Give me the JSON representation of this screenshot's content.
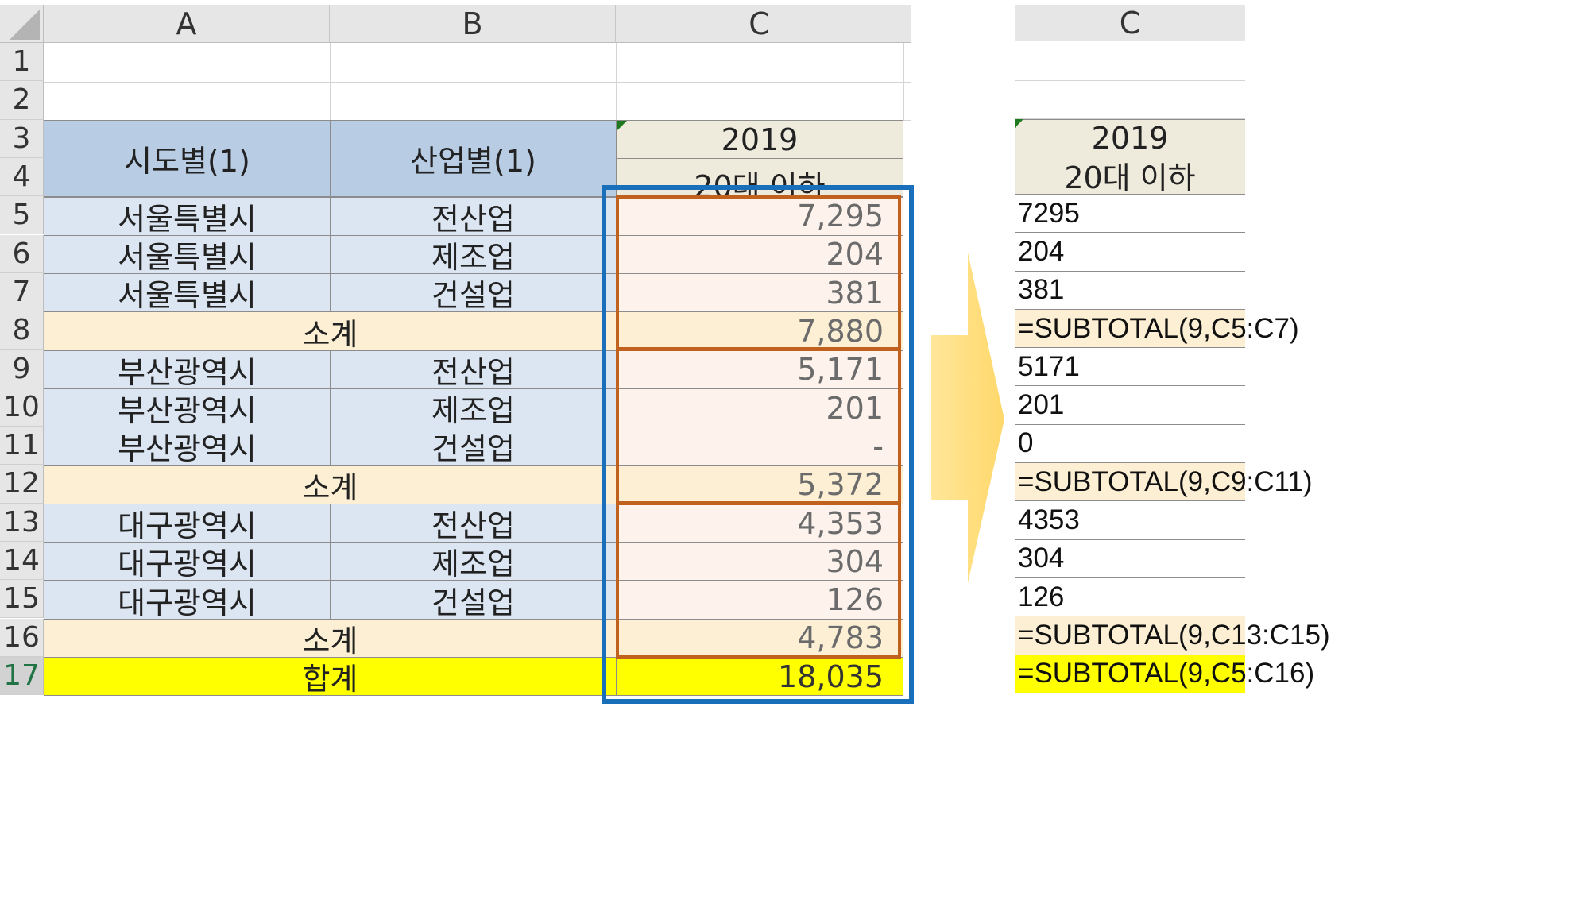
{
  "left_sheet": {
    "columns": [
      "A",
      "B",
      "C"
    ],
    "row_numbers": [
      "1",
      "2",
      "3",
      "4",
      "5",
      "6",
      "7",
      "8",
      "9",
      "10",
      "11",
      "12",
      "13",
      "14",
      "15",
      "16",
      "17"
    ],
    "header": {
      "col_a": "시도별(1)",
      "col_b": "산업별(1)",
      "year": "2019",
      "age": "20대 이하"
    },
    "rows": [
      {
        "a": "서울특별시",
        "b": "전산업",
        "c": "7,295"
      },
      {
        "a": "서울특별시",
        "b": "제조업",
        "c": "204"
      },
      {
        "a": "서울특별시",
        "b": "건설업",
        "c": "381"
      },
      {
        "subtotal": "소계",
        "c": "7,880"
      },
      {
        "a": "부산광역시",
        "b": "전산업",
        "c": "5,171"
      },
      {
        "a": "부산광역시",
        "b": "제조업",
        "c": "201"
      },
      {
        "a": "부산광역시",
        "b": "건설업",
        "c": "-"
      },
      {
        "subtotal": "소계",
        "c": "5,372"
      },
      {
        "a": "대구광역시",
        "b": "전산업",
        "c": "4,353"
      },
      {
        "a": "대구광역시",
        "b": "제조업",
        "c": "304"
      },
      {
        "a": "대구광역시",
        "b": "건설업",
        "c": "126"
      },
      {
        "subtotal": "소계",
        "c": "4,783"
      },
      {
        "total": "합계",
        "c": "18,035"
      }
    ]
  },
  "right_sheet": {
    "column": "C",
    "year": "2019",
    "age": "20대 이하",
    "values": [
      "7295",
      "204",
      "381",
      "=SUBTOTAL(9,C5:C7)",
      "5171",
      "201",
      "0",
      "=SUBTOTAL(9,C9:C11)",
      "4353",
      "304",
      "126",
      "=SUBTOTAL(9,C13:C15)",
      "=SUBTOTAL(9,C5:C16)"
    ]
  },
  "colors": {
    "header_blue": "#b8cce4",
    "data_blue": "#dce6f2",
    "subtotal_beige": "#fcefd4",
    "total_yellow": "#ffff00",
    "highlight_blue": "#1a6fba",
    "highlight_orange": "#c0621e",
    "arrow_yellow": "#ffdf7e"
  }
}
